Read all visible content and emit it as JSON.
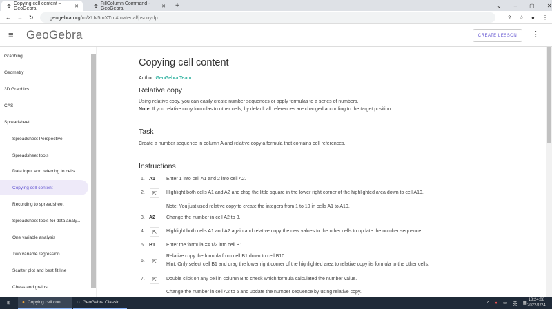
{
  "browser": {
    "tabs": [
      {
        "title": "Copying cell content – GeoGebra"
      },
      {
        "title": "FillColumn Command - GeoGebra"
      }
    ],
    "url_domain": "geogebra.org",
    "url_path": "/m/XUv5mXTm#material/pscuyrfp"
  },
  "header": {
    "logo": "GeoGebra",
    "create_lesson": "CREATE LESSON"
  },
  "sidebar": {
    "items": [
      {
        "label": "Graphing"
      },
      {
        "label": "Geometry"
      },
      {
        "label": "3D Graphics"
      },
      {
        "label": "CAS"
      },
      {
        "label": "Spreadsheet"
      },
      {
        "label": "Spreadsheet Perspective"
      },
      {
        "label": "Spreadsheet tools"
      },
      {
        "label": "Data input and referring to cells"
      },
      {
        "label": "Copying cell content"
      },
      {
        "label": "Recording to spreadsheet"
      },
      {
        "label": "Spreadsheet tools for data analy..."
      },
      {
        "label": "One variable analysis"
      },
      {
        "label": "Two variable regression"
      },
      {
        "label": "Scatter plot and best fit line"
      },
      {
        "label": "Chess and grains"
      }
    ]
  },
  "content": {
    "title": "Copying cell content",
    "author_label": "Author:",
    "author": "GeoGebra Team",
    "relative_heading": "Relative copy",
    "relative_text": "Using relative copy, you can easily create number sequences or apply formulas to a series of numbers.",
    "note_label": "Note:",
    "note_text": " If you relative copy formulas to other cells, by default all references are changed according to the target position.",
    "task_heading": "Task",
    "task_text": "Create a number sequence in column A and relative copy a formula that contains cell references.",
    "instructions_heading": "Instructions",
    "steps": [
      {
        "n": "1.",
        "key": "A1",
        "text": "Enter 1 into cell A1 and 2 into cell A2."
      },
      {
        "n": "2.",
        "text": "Highlight both cells A1 and A2 and drag the little square in the lower right corner of the highlighted area down to cell A10."
      },
      {
        "note": "Note: You just used relative copy to create the integers from 1 to 10 in cells A1 to A10."
      },
      {
        "n": "3.",
        "key": "A2",
        "text": "Change the number in cell A2 to 3."
      },
      {
        "n": "4.",
        "text": "Highlight both cells A1 and A2 again and relative copy the new values to the other cells to update the number sequence."
      },
      {
        "n": "5.",
        "key": "B1",
        "text": "Enter the formula =A1/2 into cell B1."
      },
      {
        "n": "6.",
        "text": "Relative copy the formula from cell B1 down to cell B10.",
        "hint": "Hint: Only select cell B1 and drag the lower right corner of the highlighted area to relative copy its formula to the other cells."
      },
      {
        "n": "7.",
        "text": "Double click on any cell in column B to check which formula calculated the number value."
      },
      {
        "text": "Change the number in cell A2 to 5 and update the number sequence by using relative copy."
      }
    ]
  },
  "taskbar": {
    "apps": [
      {
        "label": "Copying cell cont..."
      },
      {
        "label": "GeoGebra Classic..."
      }
    ],
    "time": "18:24:08",
    "date": "2022/1/24"
  }
}
